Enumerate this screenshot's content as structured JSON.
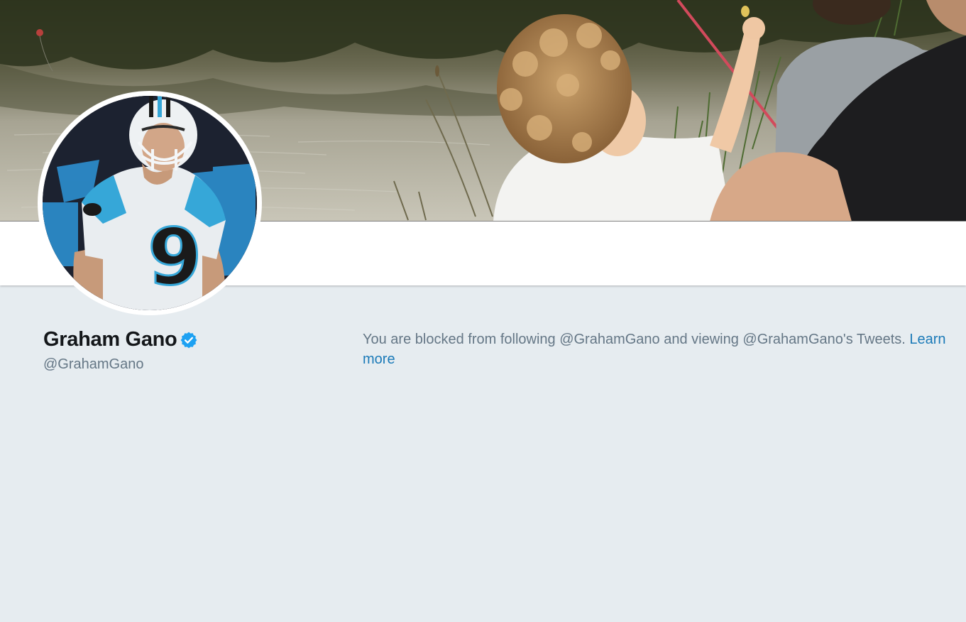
{
  "profile": {
    "name": "Graham Gano",
    "handle": "@GrahamGano",
    "verified": true
  },
  "notice": {
    "text": "You are blocked from following @GrahamGano and viewing @GrahamGano's Tweets. ",
    "link_label": "Learn more"
  },
  "images": {
    "banner": "banner-photo",
    "avatar": "avatar-photo"
  },
  "colors": {
    "background": "#e6ecf0",
    "name": "#14171a",
    "secondary_text": "#657786",
    "link": "#1b7ab8",
    "verified": "#1da1f2"
  }
}
